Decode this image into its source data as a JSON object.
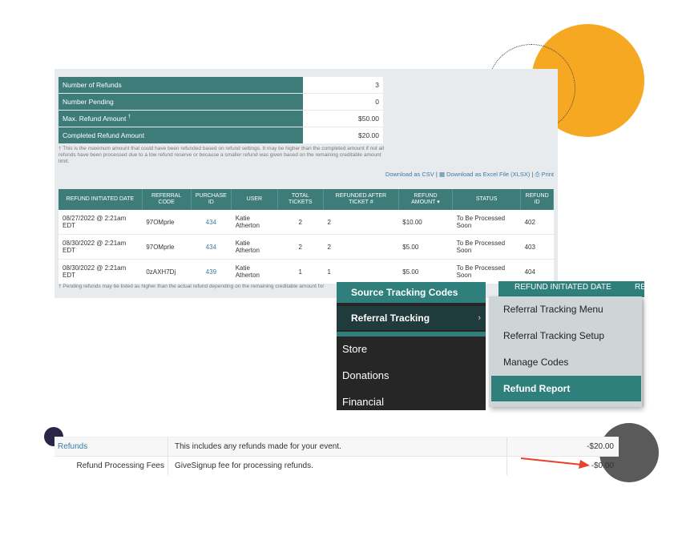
{
  "colors": {
    "teal": "#3e7c7a",
    "orange": "#f7a822",
    "link": "#3a7ca5",
    "arrow": "#e8412a"
  },
  "summary": [
    {
      "label": "Number of Refunds",
      "value": "3",
      "sup": ""
    },
    {
      "label": "Number Pending",
      "value": "0",
      "sup": ""
    },
    {
      "label": "Max. Refund Amount",
      "value": "$50.00",
      "sup": "†"
    },
    {
      "label": "Completed Refund Amount",
      "value": "$20.00",
      "sup": ""
    }
  ],
  "footnote1": "† This is the maximum amount that could have been refunded based on refund settings. It may be higher than the completed amount if not all refunds have been processed due to a low refund reserve or because a smaller refund was given based on the remaining creditable amount limit.",
  "downloads": {
    "csv": "Download as CSV",
    "sep": "|",
    "xlsx": "Download as Excel File (XLSX)",
    "print": "Print"
  },
  "refund_table": {
    "headers": [
      "REFUND INITIATED DATE",
      "REFERRAL CODE",
      "PURCHASE ID",
      "USER",
      "TOTAL TICKETS",
      "REFUNDED AFTER TICKET #",
      "REFUND AMOUNT",
      "STATUS",
      "REFUND ID"
    ],
    "rows": [
      {
        "date": "08/27/2022 @ 2:21am EDT",
        "code": "97OMprle",
        "purchase": "434",
        "user": "Katie Atherton",
        "tickets": "2",
        "after": "2",
        "amount": "$10.00",
        "status": "To Be Processed Soon",
        "id": "402"
      },
      {
        "date": "08/30/2022 @ 2:21am EDT",
        "code": "97OMprle",
        "purchase": "434",
        "user": "Katie Atherton",
        "tickets": "2",
        "after": "2",
        "amount": "$5.00",
        "status": "To Be Processed Soon",
        "id": "403"
      },
      {
        "date": "08/30/2022 @ 2:21am EDT",
        "code": "0zAXH7Dj",
        "purchase": "439",
        "user": "Katie Atherton",
        "tickets": "1",
        "after": "1",
        "amount": "$5.00",
        "status": "To Be Processed Soon",
        "id": "404"
      }
    ]
  },
  "footnote2": "† Pending refunds may be listed as higher than the actual refund depending on the remaining creditable amount for",
  "nav": {
    "source_tracking": "Source Tracking Codes",
    "referral_tracking": "Referral Tracking",
    "store": "Store",
    "donations": "Donations",
    "financial": "Financial"
  },
  "header_strip": {
    "col1": "REFUND INITIATED DATE",
    "col2": "RE"
  },
  "submenu": [
    "Referral Tracking Menu",
    "Referral Tracking Setup",
    "Manage Codes",
    "Refund Report"
  ],
  "financial": [
    {
      "name": "Refunds",
      "desc": "This includes any refunds made for your event.",
      "amount": "-$20.00"
    },
    {
      "name": "Refund Processing Fees",
      "desc": "GiveSignup fee for processing refunds.",
      "amount": "-$0.00"
    }
  ]
}
